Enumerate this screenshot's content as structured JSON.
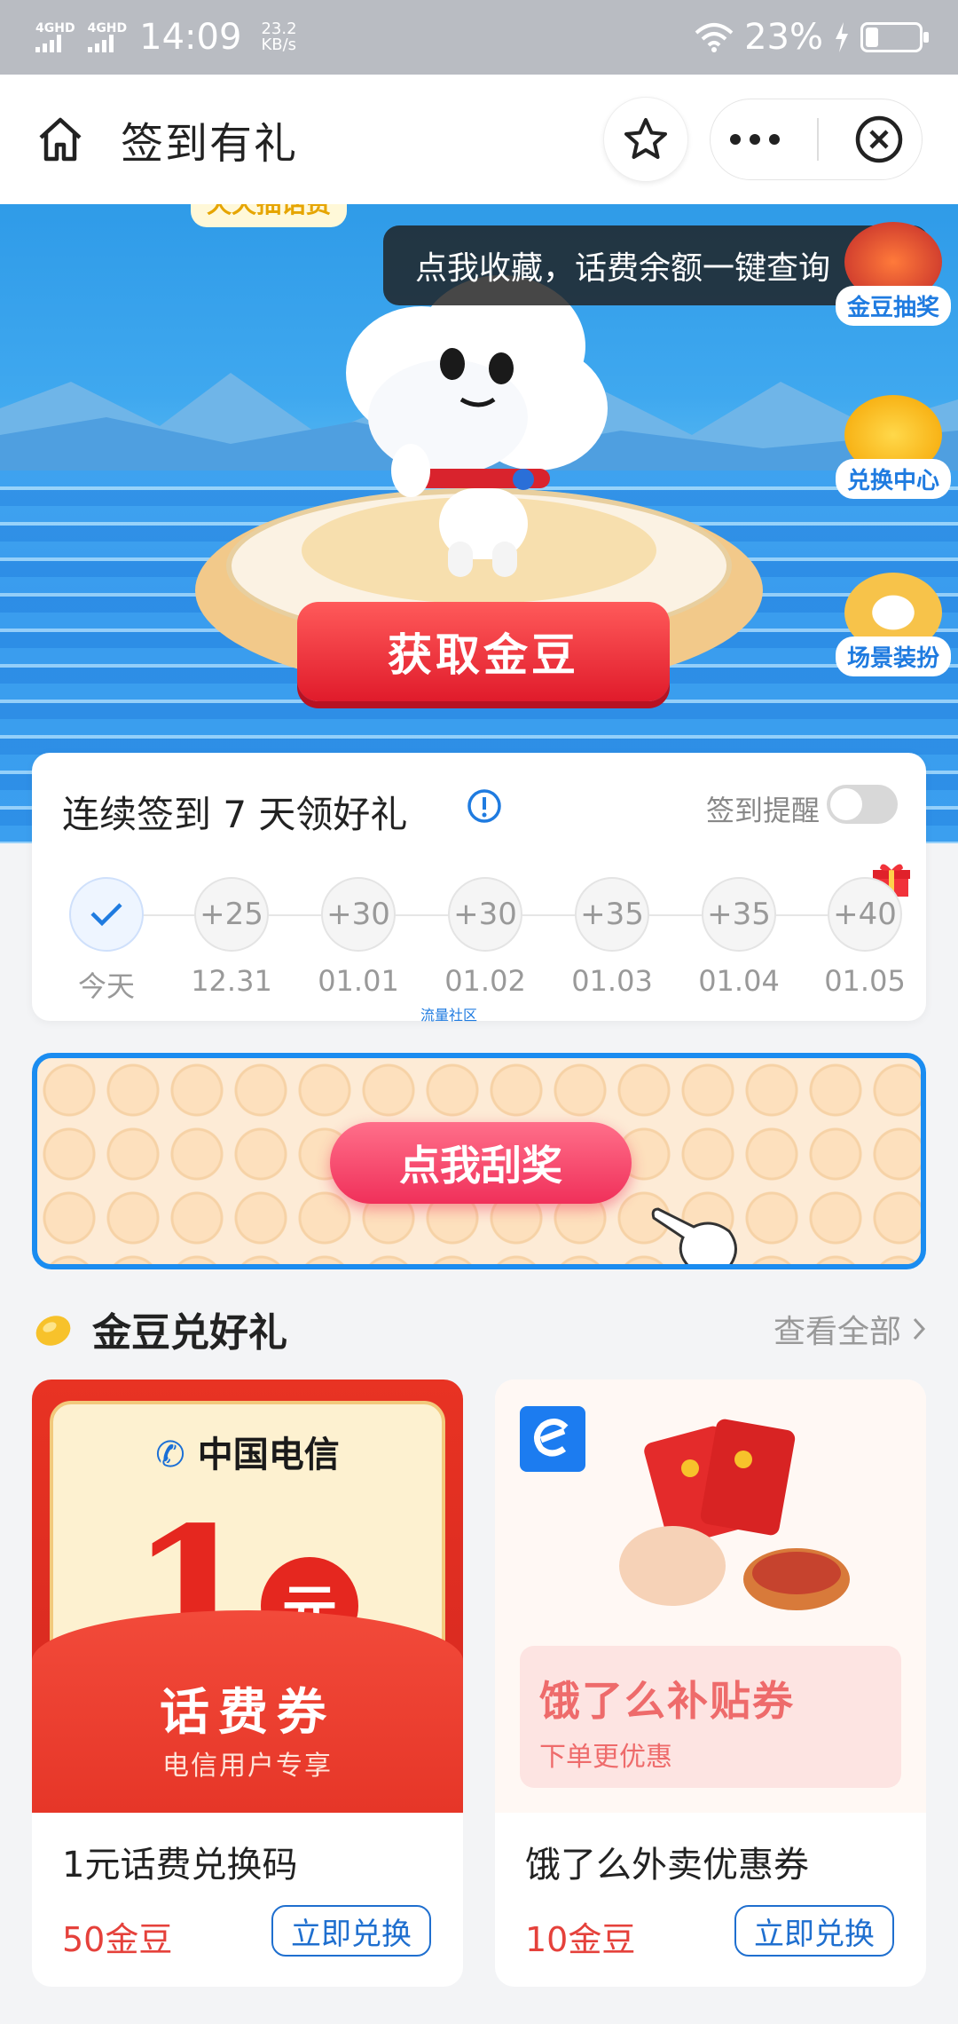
{
  "status_bar": {
    "network1": "4GHD",
    "network2": "4GHD",
    "time": "14:09",
    "speed_value": "23.2",
    "speed_unit": "KB/s",
    "battery": "23%"
  },
  "nav": {
    "title": "签到有礼"
  },
  "banner": {
    "tooltip": "点我收藏，话费余额一键查询",
    "bubble": "天天抽话费",
    "get_beans": "获取金豆",
    "side": {
      "lottery": "金豆抽奖",
      "exchange": "兑换中心",
      "scene": "场景装扮"
    }
  },
  "checkin": {
    "title": "连续签到 7 天领好礼",
    "remind_label": "签到提醒",
    "remind_on": false,
    "days": [
      {
        "reward": "",
        "date": "今天",
        "checked": true
      },
      {
        "reward": "+25",
        "date": "12.31"
      },
      {
        "reward": "+30",
        "date": "01.01"
      },
      {
        "reward": "+30",
        "date": "01.02"
      },
      {
        "reward": "+35",
        "date": "01.03"
      },
      {
        "reward": "+35",
        "date": "01.04"
      },
      {
        "reward": "+40",
        "date": "01.05"
      }
    ],
    "watermark": "流量社区"
  },
  "scratch": {
    "button": "点我刮奖"
  },
  "section": {
    "title": "金豆兑好礼",
    "view_all": "查看全部"
  },
  "cards": [
    {
      "telecom": "中国电信",
      "big": "1",
      "unit": "元",
      "label": "话费券",
      "sub": "电信用户专享",
      "name": "1元话费兑换码",
      "price": "50金豆",
      "button": "立即兑换"
    },
    {
      "panel_title": "饿了么补贴券",
      "panel_sub": "下单更优惠",
      "name": "饿了么外卖优惠券",
      "price": "10金豆",
      "button": "立即兑换"
    }
  ],
  "colors": {
    "accent_blue": "#1f7be0",
    "price_red": "#e5413b",
    "button_red": "#e01b2b"
  }
}
